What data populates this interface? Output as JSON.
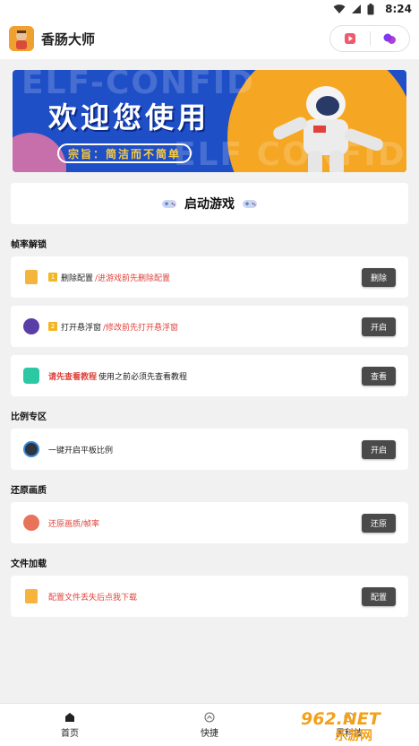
{
  "status": {
    "time": "8:24"
  },
  "app": {
    "title": "香肠大师"
  },
  "banner": {
    "main_text": "欢迎您使用",
    "motto": "宗旨：简洁而不简单",
    "bg_text_top": "ELF-CONFID",
    "bg_text_bottom": "ELF CONFIDEN"
  },
  "start": {
    "label": "启动游戏"
  },
  "sections": {
    "frame_unlock": {
      "title": "帧率解锁",
      "rows": [
        {
          "badge": "1",
          "prefix": "删除配置",
          "suffix": "/进游戏前先删除配置",
          "button": "删除"
        },
        {
          "badge": "2",
          "prefix": "打开悬浮窗",
          "suffix": "/修改前先打开悬浮窗",
          "button": "开启"
        },
        {
          "prefix": "请先查看教程",
          "suffix": "使用之前必须先查看教程",
          "button": "查看"
        }
      ]
    },
    "ratio": {
      "title": "比例专区",
      "rows": [
        {
          "text": "一键开启平板比例",
          "button": "开启"
        }
      ]
    },
    "restore": {
      "title": "还原画质",
      "rows": [
        {
          "text": "还原画质/帧率",
          "button": "还原"
        }
      ]
    },
    "file_load": {
      "title": "文件加载",
      "rows": [
        {
          "text": "配置文件丢失后点我下载",
          "button": "配置"
        }
      ]
    }
  },
  "nav": {
    "items": [
      {
        "label": "首页",
        "icon": "home-icon"
      },
      {
        "label": "快捷",
        "icon": "gamepad-icon"
      },
      {
        "label": "黑科技",
        "icon": "compass-icon"
      }
    ]
  },
  "watermark": {
    "text": "962.NET 乐游网"
  },
  "colors": {
    "accent_red": "#e0413a",
    "button_dark": "#4a4a4a",
    "banner_blue": "#1f4fc7"
  }
}
